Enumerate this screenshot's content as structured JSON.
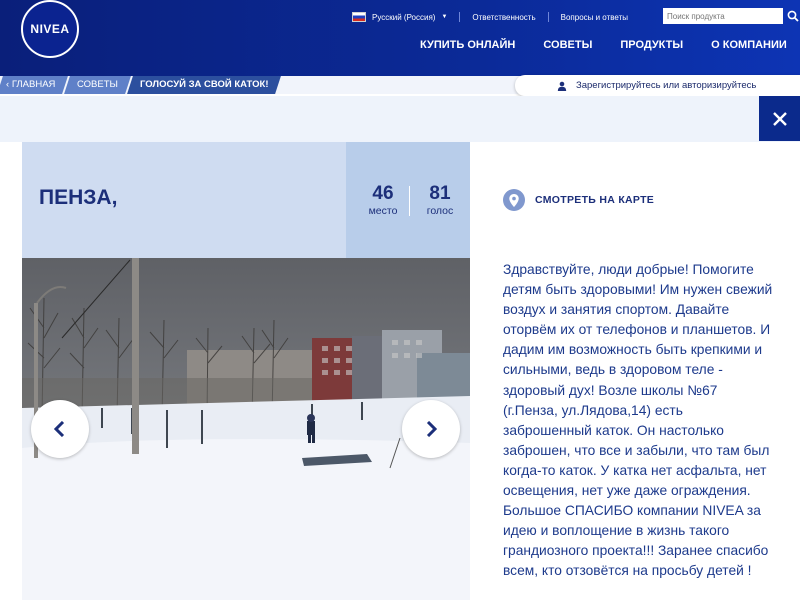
{
  "brand": {
    "logo_text": "NIVEA"
  },
  "topbar": {
    "language": "Русский (Россия)",
    "links": [
      "Ответственность",
      "Вопросы и ответы"
    ],
    "search_placeholder": "Поиск продукта"
  },
  "main_nav": [
    "КУПИТЬ ОНЛАЙН",
    "СОВЕТЫ",
    "ПРОДУКТЫ",
    "О КОМПАНИИ"
  ],
  "breadcrumb": [
    "ГЛАВНАЯ",
    "СОВЕТЫ",
    "ГОЛОСУЙ ЗА СВОЙ КАТОК!"
  ],
  "auth": {
    "label": "Зарегистрируйтесь или авторизируйтесь"
  },
  "rink": {
    "city": "ПЕНЗА,",
    "place_value": "46",
    "place_label": "место",
    "votes_value": "81",
    "votes_label": "голос",
    "map_link": "СМОТРЕТЬ НА КАРТЕ",
    "story": "Здравствуйте, люди добрые! Помогите детям быть здоровыми! Им нужен свежий воздух и занятия спортом. Давайте оторвём их от телефонов и планшетов. И дадим им возможность быть крепкими и сильными, ведь в здоровом теле - здоровый дух! Возле школы №67 (г.Пенза, ул.Лядова,14) есть заброшенный каток. Он настолько заброшен, что все и забыли, что там был когда-то каток. У катка нет асфальта, нет освещения, нет уже даже ограждения. Большое СПАСИБО компании NIVEA за идею и воплощение в жизнь такого грандиозного проекта!!! Заранее спасибо всем, кто отзовётся на просьбу детей !"
  },
  "colors": {
    "header": "#0b2a98",
    "accent_text": "#1c2f7a",
    "city_bg": "#cfdcf1",
    "stats_bg": "#b8cdea",
    "close_bg": "#0b2a8c"
  },
  "icons": [
    "search-icon",
    "user-icon",
    "close-icon",
    "map-pin-icon",
    "chevron-left-icon",
    "chevron-right-icon"
  ]
}
